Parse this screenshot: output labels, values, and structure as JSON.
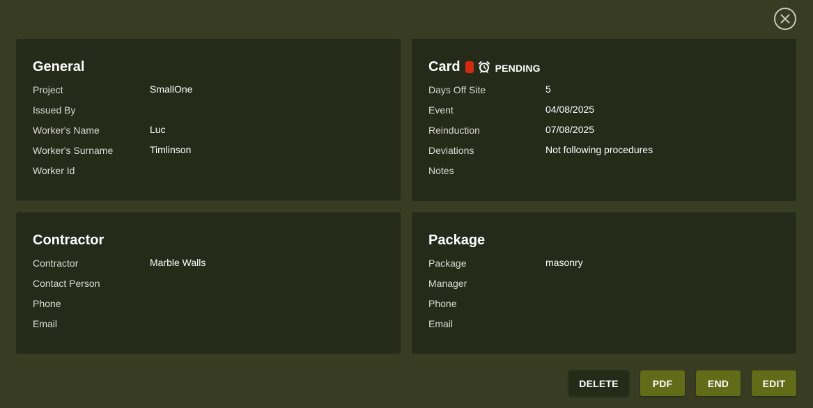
{
  "general": {
    "title": "General",
    "fields": [
      {
        "label": "Project",
        "value": "SmallOne"
      },
      {
        "label": "Issued By",
        "value": ""
      },
      {
        "label": "Worker's Name",
        "value": "Luc"
      },
      {
        "label": "Worker's Surname",
        "value": "Timlinson"
      },
      {
        "label": "Worker Id",
        "value": ""
      }
    ]
  },
  "card": {
    "title": "Card",
    "chip_color": "#d42a12",
    "status_icon": "alarm-clock-icon",
    "status": "PENDING",
    "fields": [
      {
        "label": "Days Off Site",
        "value": "5"
      },
      {
        "label": "Event",
        "value": "04/08/2025"
      },
      {
        "label": "Reinduction",
        "value": "07/08/2025"
      },
      {
        "label": "Deviations",
        "value": "Not following procedures"
      },
      {
        "label": "Notes",
        "value": ""
      }
    ]
  },
  "contractor": {
    "title": "Contractor",
    "fields": [
      {
        "label": "Contractor",
        "value": "Marble Walls"
      },
      {
        "label": "Contact Person",
        "value": ""
      },
      {
        "label": "Phone",
        "value": ""
      },
      {
        "label": "Email",
        "value": ""
      }
    ]
  },
  "package": {
    "title": "Package",
    "fields": [
      {
        "label": "Package",
        "value": "masonry"
      },
      {
        "label": "Manager",
        "value": ""
      },
      {
        "label": "Phone",
        "value": ""
      },
      {
        "label": "Email",
        "value": ""
      }
    ]
  },
  "actions": {
    "delete": "DELETE",
    "pdf": "PDF",
    "end": "END",
    "edit": "EDIT"
  },
  "colors": {
    "background": "#373c22",
    "panel": "#262a19",
    "accent_button": "#606c17",
    "danger_chip": "#d42a12"
  }
}
